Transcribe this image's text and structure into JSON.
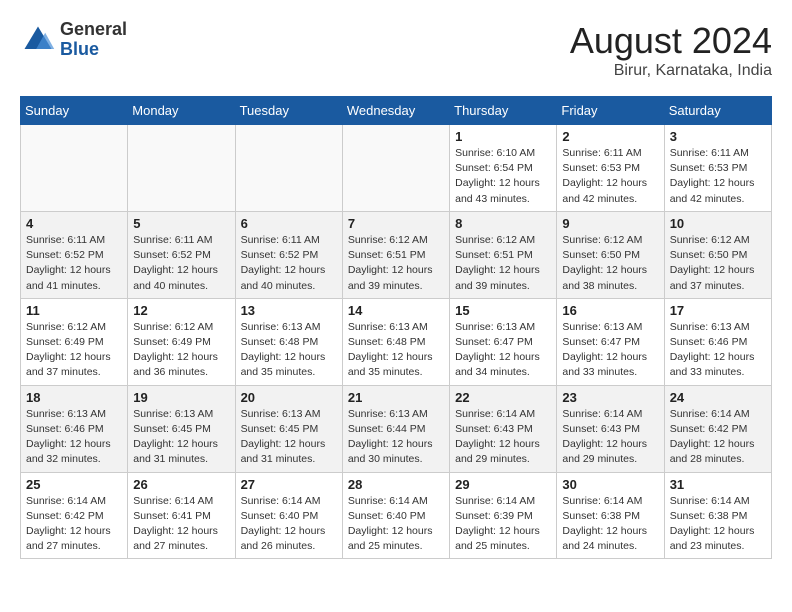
{
  "logo": {
    "general": "General",
    "blue": "Blue"
  },
  "title": "August 2024",
  "subtitle": "Birur, Karnataka, India",
  "days_of_week": [
    "Sunday",
    "Monday",
    "Tuesday",
    "Wednesday",
    "Thursday",
    "Friday",
    "Saturday"
  ],
  "weeks": [
    [
      {
        "day": "",
        "empty": true
      },
      {
        "day": "",
        "empty": true
      },
      {
        "day": "",
        "empty": true
      },
      {
        "day": "",
        "empty": true
      },
      {
        "day": "1",
        "sunrise": "6:10 AM",
        "sunset": "6:54 PM",
        "daylight": "12 hours and 43 minutes."
      },
      {
        "day": "2",
        "sunrise": "6:11 AM",
        "sunset": "6:53 PM",
        "daylight": "12 hours and 42 minutes."
      },
      {
        "day": "3",
        "sunrise": "6:11 AM",
        "sunset": "6:53 PM",
        "daylight": "12 hours and 42 minutes."
      }
    ],
    [
      {
        "day": "4",
        "sunrise": "6:11 AM",
        "sunset": "6:52 PM",
        "daylight": "12 hours and 41 minutes."
      },
      {
        "day": "5",
        "sunrise": "6:11 AM",
        "sunset": "6:52 PM",
        "daylight": "12 hours and 40 minutes."
      },
      {
        "day": "6",
        "sunrise": "6:11 AM",
        "sunset": "6:52 PM",
        "daylight": "12 hours and 40 minutes."
      },
      {
        "day": "7",
        "sunrise": "6:12 AM",
        "sunset": "6:51 PM",
        "daylight": "12 hours and 39 minutes."
      },
      {
        "day": "8",
        "sunrise": "6:12 AM",
        "sunset": "6:51 PM",
        "daylight": "12 hours and 39 minutes."
      },
      {
        "day": "9",
        "sunrise": "6:12 AM",
        "sunset": "6:50 PM",
        "daylight": "12 hours and 38 minutes."
      },
      {
        "day": "10",
        "sunrise": "6:12 AM",
        "sunset": "6:50 PM",
        "daylight": "12 hours and 37 minutes."
      }
    ],
    [
      {
        "day": "11",
        "sunrise": "6:12 AM",
        "sunset": "6:49 PM",
        "daylight": "12 hours and 37 minutes."
      },
      {
        "day": "12",
        "sunrise": "6:12 AM",
        "sunset": "6:49 PM",
        "daylight": "12 hours and 36 minutes."
      },
      {
        "day": "13",
        "sunrise": "6:13 AM",
        "sunset": "6:48 PM",
        "daylight": "12 hours and 35 minutes."
      },
      {
        "day": "14",
        "sunrise": "6:13 AM",
        "sunset": "6:48 PM",
        "daylight": "12 hours and 35 minutes."
      },
      {
        "day": "15",
        "sunrise": "6:13 AM",
        "sunset": "6:47 PM",
        "daylight": "12 hours and 34 minutes."
      },
      {
        "day": "16",
        "sunrise": "6:13 AM",
        "sunset": "6:47 PM",
        "daylight": "12 hours and 33 minutes."
      },
      {
        "day": "17",
        "sunrise": "6:13 AM",
        "sunset": "6:46 PM",
        "daylight": "12 hours and 33 minutes."
      }
    ],
    [
      {
        "day": "18",
        "sunrise": "6:13 AM",
        "sunset": "6:46 PM",
        "daylight": "12 hours and 32 minutes."
      },
      {
        "day": "19",
        "sunrise": "6:13 AM",
        "sunset": "6:45 PM",
        "daylight": "12 hours and 31 minutes."
      },
      {
        "day": "20",
        "sunrise": "6:13 AM",
        "sunset": "6:45 PM",
        "daylight": "12 hours and 31 minutes."
      },
      {
        "day": "21",
        "sunrise": "6:13 AM",
        "sunset": "6:44 PM",
        "daylight": "12 hours and 30 minutes."
      },
      {
        "day": "22",
        "sunrise": "6:14 AM",
        "sunset": "6:43 PM",
        "daylight": "12 hours and 29 minutes."
      },
      {
        "day": "23",
        "sunrise": "6:14 AM",
        "sunset": "6:43 PM",
        "daylight": "12 hours and 29 minutes."
      },
      {
        "day": "24",
        "sunrise": "6:14 AM",
        "sunset": "6:42 PM",
        "daylight": "12 hours and 28 minutes."
      }
    ],
    [
      {
        "day": "25",
        "sunrise": "6:14 AM",
        "sunset": "6:42 PM",
        "daylight": "12 hours and 27 minutes."
      },
      {
        "day": "26",
        "sunrise": "6:14 AM",
        "sunset": "6:41 PM",
        "daylight": "12 hours and 27 minutes."
      },
      {
        "day": "27",
        "sunrise": "6:14 AM",
        "sunset": "6:40 PM",
        "daylight": "12 hours and 26 minutes."
      },
      {
        "day": "28",
        "sunrise": "6:14 AM",
        "sunset": "6:40 PM",
        "daylight": "12 hours and 25 minutes."
      },
      {
        "day": "29",
        "sunrise": "6:14 AM",
        "sunset": "6:39 PM",
        "daylight": "12 hours and 25 minutes."
      },
      {
        "day": "30",
        "sunrise": "6:14 AM",
        "sunset": "6:38 PM",
        "daylight": "12 hours and 24 minutes."
      },
      {
        "day": "31",
        "sunrise": "6:14 AM",
        "sunset": "6:38 PM",
        "daylight": "12 hours and 23 minutes."
      }
    ]
  ],
  "labels": {
    "sunrise": "Sunrise:",
    "sunset": "Sunset:",
    "daylight": "Daylight:"
  }
}
